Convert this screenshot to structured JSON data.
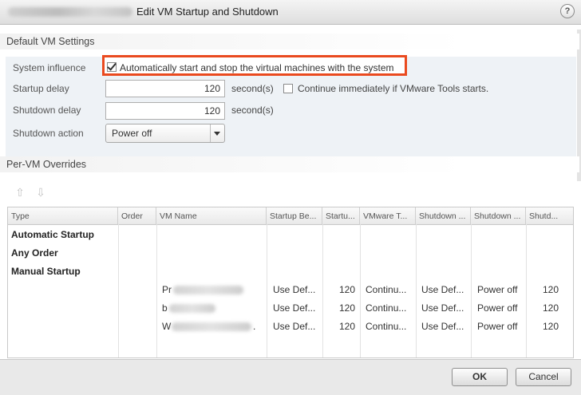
{
  "window": {
    "title": "Edit VM Startup and Shutdown",
    "help_label": "?"
  },
  "default_settings": {
    "header": "Default VM Settings",
    "system_influence": {
      "label": "System influence",
      "checkbox_label": "Automatically start and stop the virtual machines with the system",
      "checked": true
    },
    "startup_delay": {
      "label": "Startup delay",
      "value": "120",
      "unit": "second(s)",
      "continue_label": "Continue immediately if VMware Tools starts.",
      "continue_checked": false
    },
    "shutdown_delay": {
      "label": "Shutdown delay",
      "value": "120",
      "unit": "second(s)"
    },
    "shutdown_action": {
      "label": "Shutdown action",
      "value": "Power off"
    }
  },
  "overrides": {
    "header": "Per-VM Overrides",
    "move_up_icon": "up-arrow-icon",
    "move_down_icon": "down-arrow-icon",
    "columns": [
      "Type",
      "Order",
      "VM Name",
      "Startup Be...",
      "Startu...",
      "VMware T...",
      "Shutdown ...",
      "Shutdown ...",
      "Shutd..."
    ],
    "groups": [
      "Automatic Startup",
      "Any Order",
      "Manual Startup"
    ],
    "vms": [
      {
        "name_prefix": "Pr",
        "name_suffix": "",
        "startup_behavior": "Use Def...",
        "startup_delay": "120",
        "vmware_tools": "Continu...",
        "shutdown_behavior": "Use Def...",
        "shutdown_action": "Power off",
        "shutdown_delay": "120"
      },
      {
        "name_prefix": "b",
        "name_suffix": "",
        "startup_behavior": "Use Def...",
        "startup_delay": "120",
        "vmware_tools": "Continu...",
        "shutdown_behavior": "Use Def...",
        "shutdown_action": "Power off",
        "shutdown_delay": "120"
      },
      {
        "name_prefix": "W",
        "name_suffix": ".",
        "startup_behavior": "Use Def...",
        "startup_delay": "120",
        "vmware_tools": "Continu...",
        "shutdown_behavior": "Use Def...",
        "shutdown_action": "Power off",
        "shutdown_delay": "120"
      }
    ]
  },
  "footer": {
    "ok_label": "OK",
    "cancel_label": "Cancel"
  },
  "colors": {
    "highlight": "#ea4a1f",
    "settings_panel": "#eef2f6"
  }
}
